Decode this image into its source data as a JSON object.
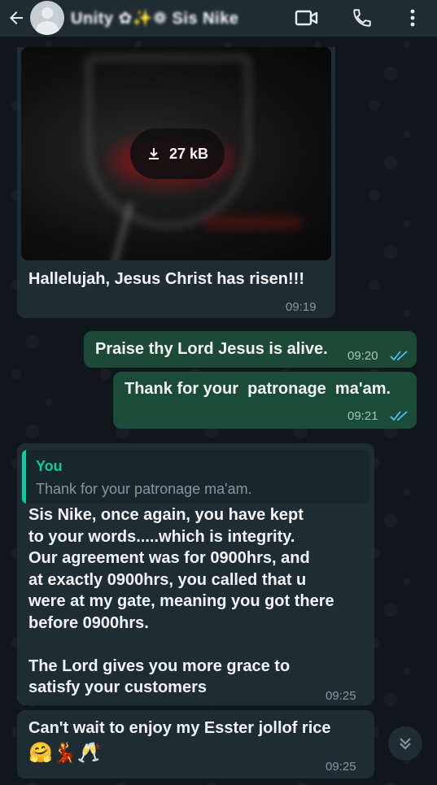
{
  "header": {
    "contact_name": "Unity ✿✨❁ Sis Nike",
    "back_icon": "arrow-left-icon",
    "avatar_icon": "default-avatar-icon",
    "video_icon": "video-call-icon",
    "call_icon": "phone-icon",
    "menu_icon": "more-vertical-icon"
  },
  "messages": {
    "m1": {
      "download_size": "27 kB",
      "text": "Hallelujah, Jesus Christ has risen!!!",
      "time": "09:19"
    },
    "m2": {
      "text": "Praise thy Lord Jesus is alive.",
      "time": "09:20"
    },
    "m3": {
      "text": "Thank for your  patronage  ma'am.",
      "time": "09:21"
    },
    "m4": {
      "quote_author": "You",
      "quote_text": "Thank for your  patronage  ma'am.",
      "text": "Sis Nike, once again, you have kept\nto your words.....which is integrity.\nOur agreement was for 0900hrs, and\nat exactly 0900hrs, you called that u\nwere at my gate, meaning you got there\nbefore 0900hrs.\n\nThe Lord gives you more grace to\nsatisfy your customers",
      "time": "09:25"
    },
    "m5": {
      "text": "Can't wait to enjoy my Esster jollof rice",
      "emojis": "🤗💃🥂",
      "time": "09:25"
    }
  },
  "colors": {
    "header_bg": "#1f2c34",
    "incoming_bubble": "#1f2c34",
    "outgoing_bubble": "#1d4a38",
    "read_ticks": "#53bdeb",
    "quote_accent": "#06cf9c"
  },
  "scroll_icon": "double-chevron-down-icon"
}
